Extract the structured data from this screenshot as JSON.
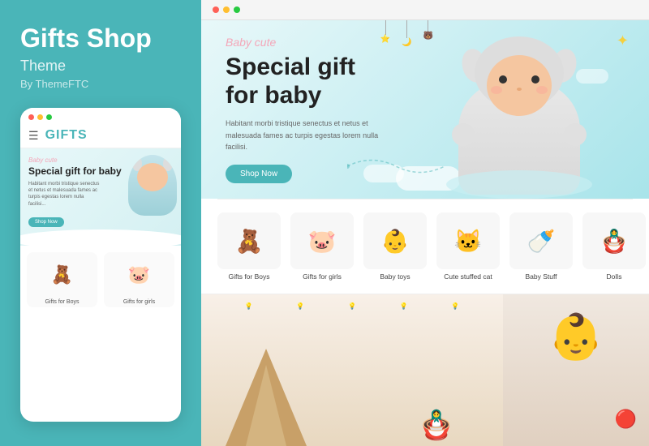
{
  "brand": {
    "title": "Gifts Shop",
    "subtitle": "Theme",
    "author": "By ThemeFTC"
  },
  "colors": {
    "dot1": "#ff6057",
    "dot2": "#ffbe2f",
    "dot3": "#28ca41",
    "teal": "#4ab5b8",
    "pink": "#f4a7b9",
    "white": "#ffffff"
  },
  "mobile": {
    "logo": "GIFTS",
    "hero": {
      "tag": "Baby cute",
      "title": "Special gift for baby",
      "desc": "Habitant morbi tristique senectus et netus et malesuada fames ac turpis egestas lorem nulla facilisi...",
      "button": "Shop Now"
    },
    "products": [
      {
        "label": "Gifts for Boys",
        "emoji": "🧸"
      },
      {
        "label": "Gifts for girls",
        "emoji": "🐷"
      }
    ]
  },
  "desktop": {
    "hero": {
      "tag": "Baby cute",
      "title_line1": "Special gift",
      "title_line2": "for baby",
      "desc": "Habitant morbi tristique senectus et netus et malesuada fames ac turpis egestas lorem nulla facilisi.",
      "button": "Shop Now"
    },
    "products": [
      {
        "name": "Gifts for Boys",
        "emoji": "🧸"
      },
      {
        "name": "Gifts for girls",
        "emoji": "🐷"
      },
      {
        "name": "Baby toys",
        "emoji": "👶"
      },
      {
        "name": "Cute stuffed cat",
        "emoji": "🐱"
      },
      {
        "name": "Baby Stuff",
        "emoji": "🍼"
      },
      {
        "name": "Dolls",
        "emoji": "🪆"
      }
    ]
  }
}
